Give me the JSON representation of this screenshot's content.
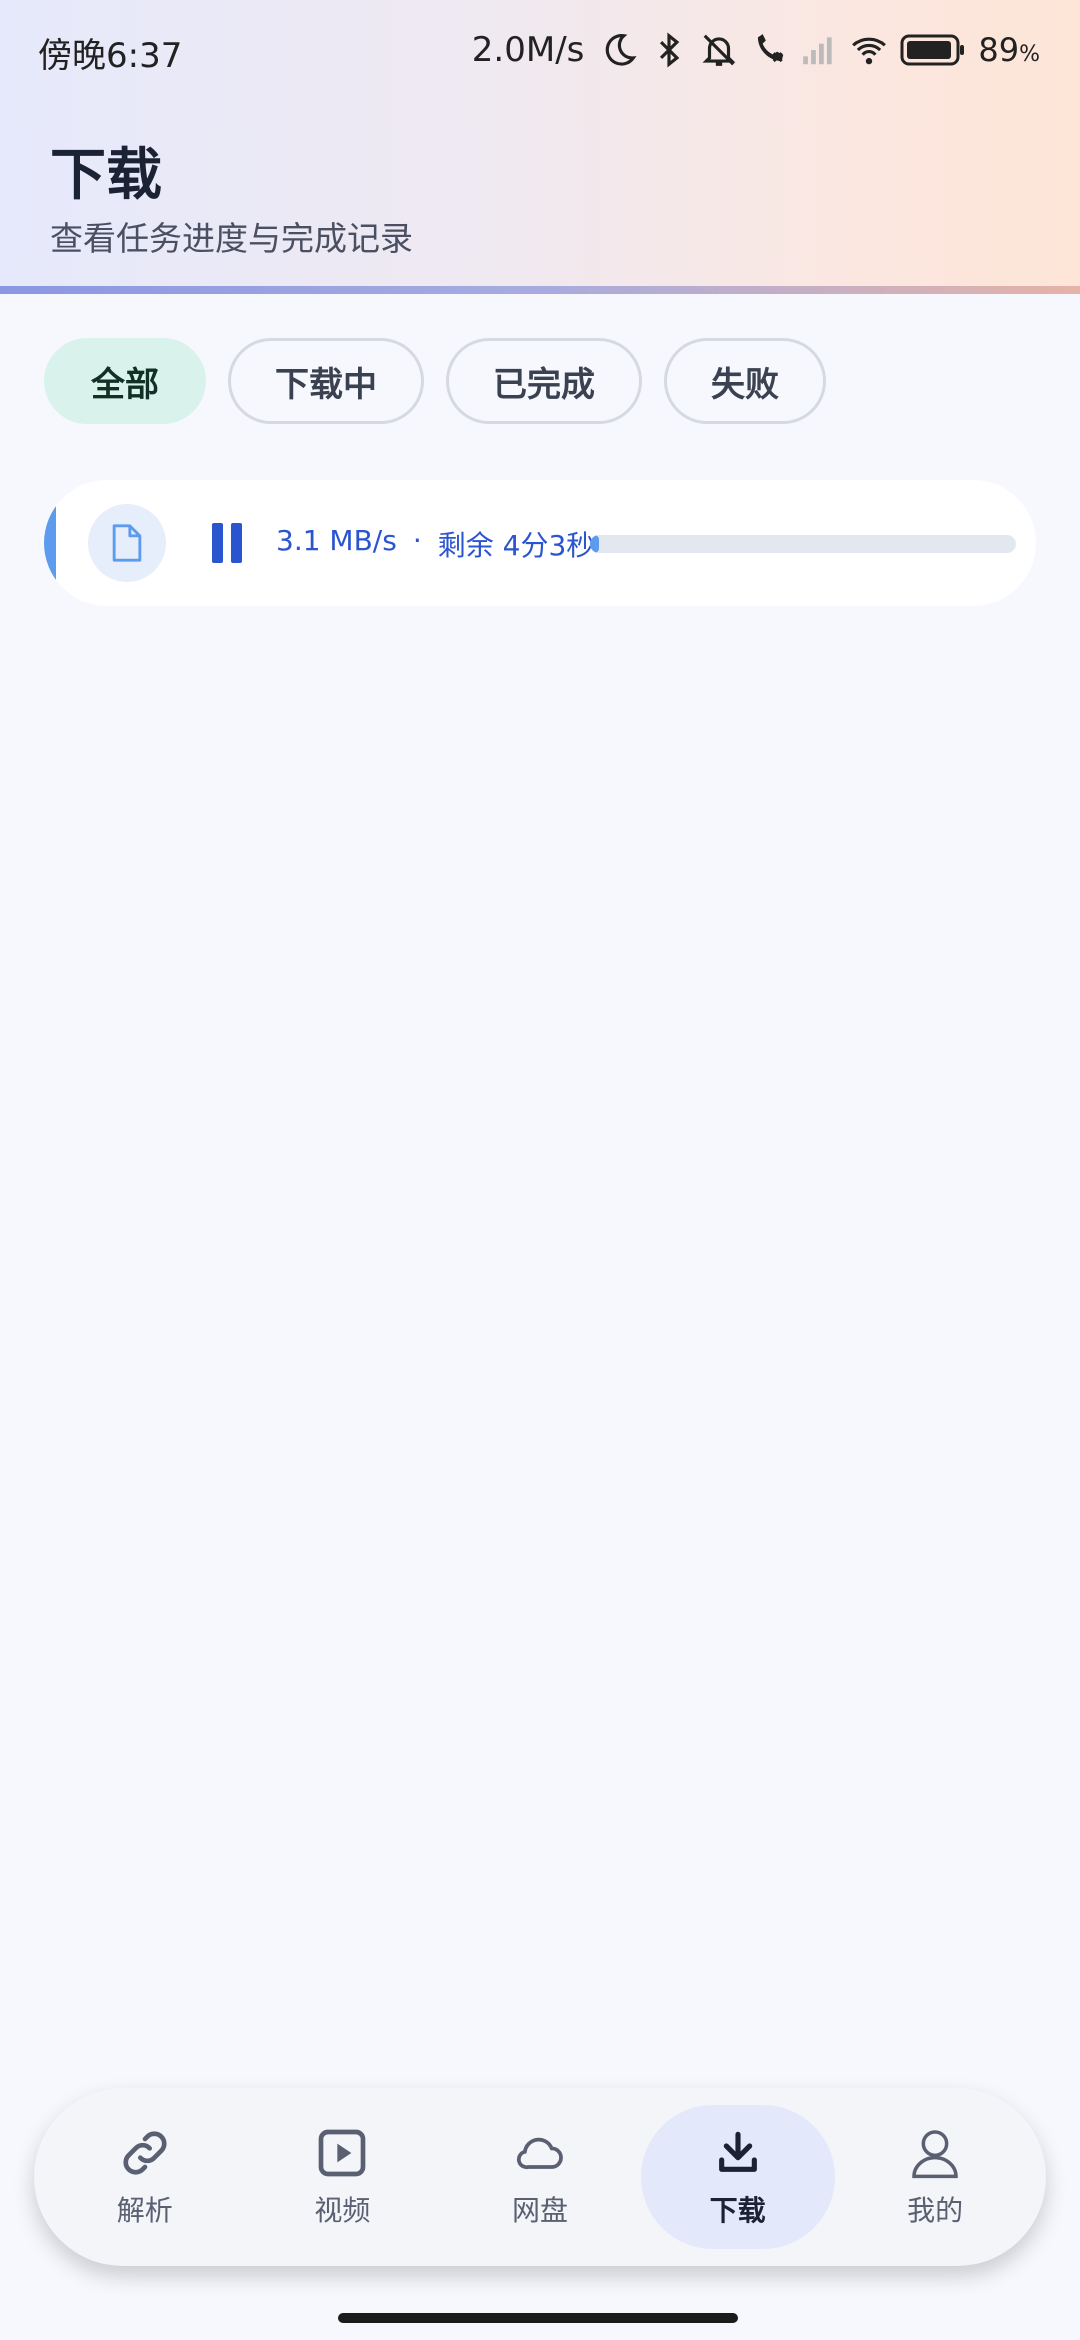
{
  "status_bar": {
    "time": "傍晚6:37",
    "net_speed": "2.0M/s",
    "battery_percent": "89",
    "battery_unit": "%",
    "icons": [
      "moon-icon",
      "bluetooth-icon",
      "mute-icon",
      "call-off-icon",
      "signal-icon",
      "wifi-icon",
      "battery-icon"
    ]
  },
  "header": {
    "title": "下载",
    "subtitle": "查看任务进度与完成记录"
  },
  "filters": {
    "active": "全部",
    "items": [
      "全部",
      "下载中",
      "已完成",
      "失败"
    ]
  },
  "download_item": {
    "speed": "3.1 MB/s",
    "separator": "·",
    "remaining": "剩余 4分3秒",
    "progress": 0.01,
    "accent_color": "#5d9bef"
  },
  "bottom_nav": {
    "active": "下载",
    "items": [
      {
        "label": "解析",
        "icon": "link-icon"
      },
      {
        "label": "视频",
        "icon": "video-icon"
      },
      {
        "label": "网盘",
        "icon": "cloud-icon"
      },
      {
        "label": "下载",
        "icon": "download-icon"
      },
      {
        "label": "我的",
        "icon": "profile-icon"
      }
    ]
  }
}
